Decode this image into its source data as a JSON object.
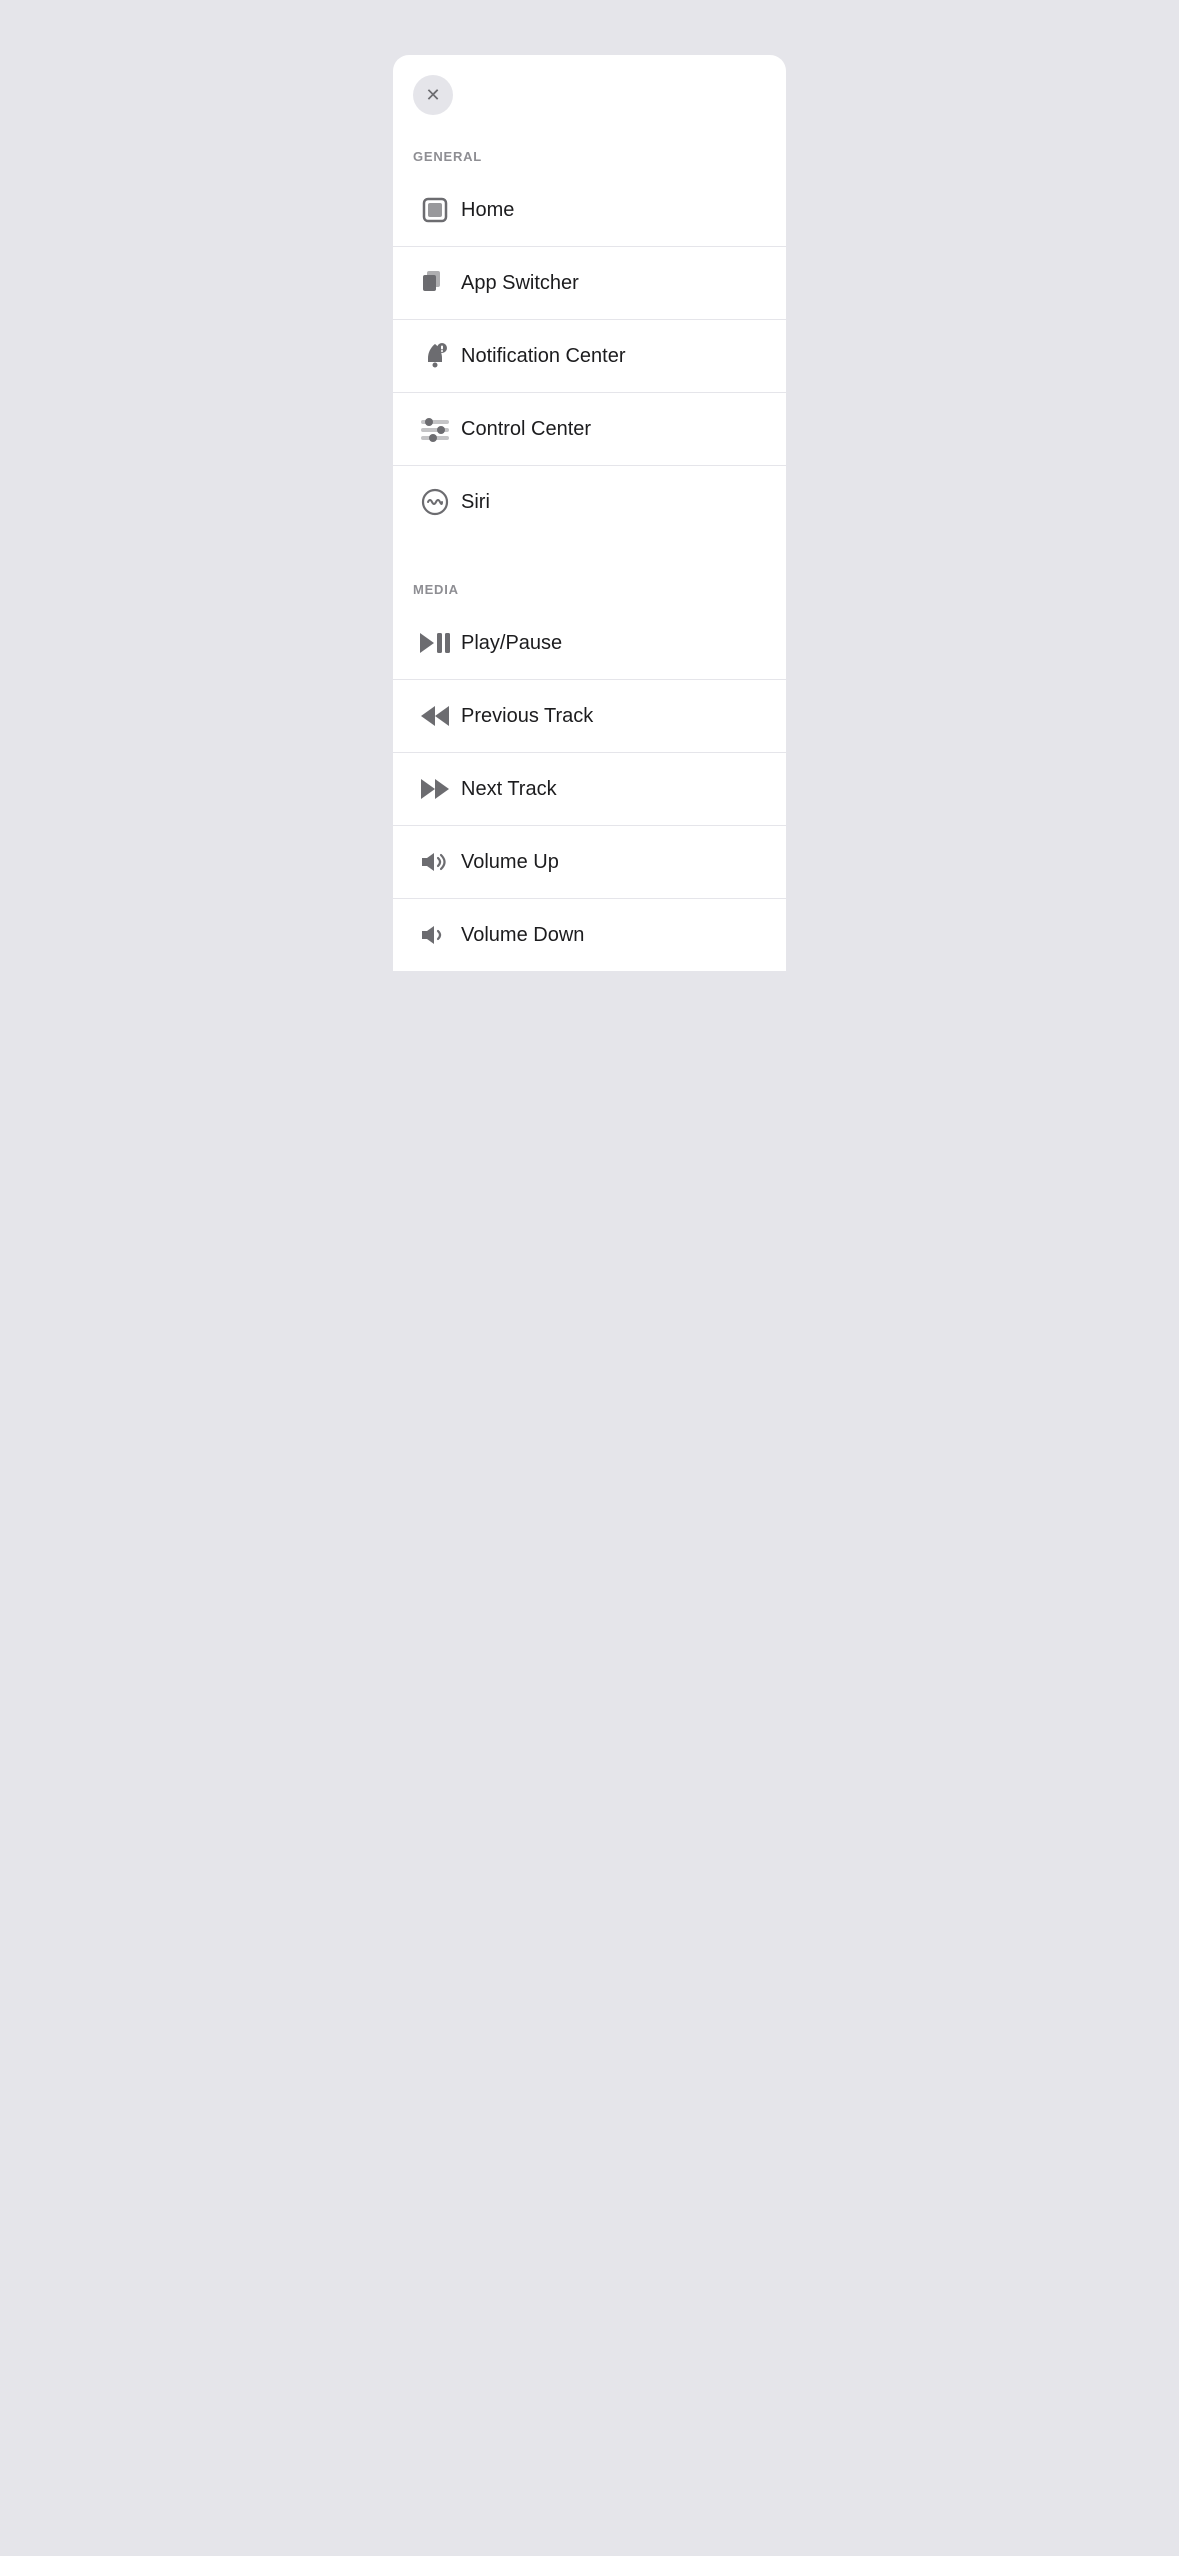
{
  "modal": {
    "close_button_label": "✕",
    "sections": [
      {
        "id": "general",
        "header": "GENERAL",
        "items": [
          {
            "id": "home",
            "label": "Home",
            "icon": "home-icon"
          },
          {
            "id": "app-switcher",
            "label": "App Switcher",
            "icon": "app-switcher-icon"
          },
          {
            "id": "notification-center",
            "label": "Notification Center",
            "icon": "notification-icon"
          },
          {
            "id": "control-center",
            "label": "Control Center",
            "icon": "control-center-icon"
          },
          {
            "id": "siri",
            "label": "Siri",
            "icon": "siri-icon"
          }
        ]
      },
      {
        "id": "media",
        "header": "MEDIA",
        "items": [
          {
            "id": "play-pause",
            "label": "Play/Pause",
            "icon": "play-pause-icon"
          },
          {
            "id": "previous-track",
            "label": "Previous Track",
            "icon": "previous-track-icon"
          },
          {
            "id": "next-track",
            "label": "Next Track",
            "icon": "next-track-icon"
          },
          {
            "id": "volume-up",
            "label": "Volume Up",
            "icon": "volume-up-icon"
          },
          {
            "id": "volume-down",
            "label": "Volume Down",
            "icon": "volume-down-icon"
          }
        ]
      }
    ]
  }
}
